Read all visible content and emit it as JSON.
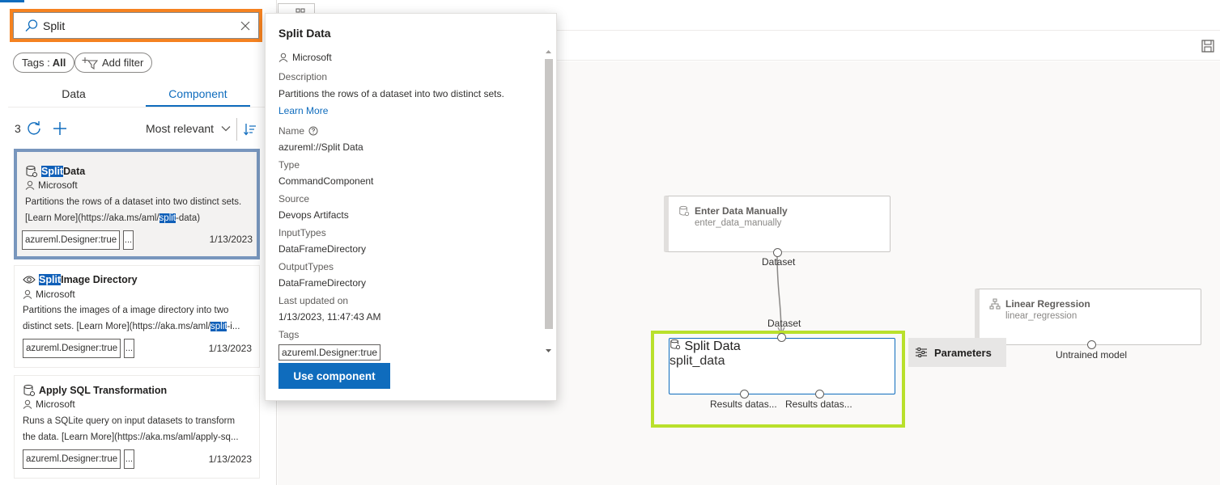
{
  "search": {
    "value": "Split",
    "placeholder": "Search"
  },
  "filters": {
    "tags_label": "Tags :",
    "tags_value": "All",
    "add_filter_label": "Add filter"
  },
  "tabs": [
    {
      "label": "Data"
    },
    {
      "label": "Component"
    }
  ],
  "list_header": {
    "count": "3",
    "sort_label": "Most relevant"
  },
  "cards": [
    {
      "title_highlight": "Split",
      "title_rest": " Data",
      "author": "Microsoft",
      "desc_line1": "Partitions the rows of a dataset into two distinct sets.",
      "desc_line2_pre": "[Learn More](https://aka.ms/aml/",
      "desc_line2_hl": "split",
      "desc_line2_post": "-data)",
      "tag": "azureml.Designer:true",
      "more": "...",
      "date": "1/13/2023"
    },
    {
      "title_highlight": "Split",
      "title_rest": " Image Directory",
      "author": "Microsoft",
      "desc_line1": "Partitions the images of a image directory into two",
      "desc_line2_pre": "distinct sets. [Learn More](https://aka.ms/aml/",
      "desc_line2_hl": "split",
      "desc_line2_post": "-i...",
      "tag": "azureml.Designer:true",
      "more": "...",
      "date": "1/13/2023"
    },
    {
      "title": "Apply SQL Transformation",
      "author": "Microsoft",
      "desc_line1": "Runs a SQLite query on input datasets to transform",
      "desc_line2": "the data. [Learn More](https://aka.ms/aml/apply-sq...",
      "tag": "azureml.Designer:true",
      "more": "...",
      "date": "1/13/2023"
    }
  ],
  "popup": {
    "title": "Split Data",
    "author": "Microsoft",
    "description_label": "Description",
    "description": "Partitions the rows of a dataset into two distinct sets.",
    "learn_more": "Learn More",
    "name_label": "Name",
    "name_value": "azureml://Split Data",
    "type_label": "Type",
    "type_value": "CommandComponent",
    "source_label": "Source",
    "source_value": "Devops Artifacts",
    "input_label": "InputTypes",
    "input_value": "DataFrameDirectory",
    "output_label": "OutputTypes",
    "output_value": "DataFrameDirectory",
    "updated_label": "Last updated on",
    "updated_value": "1/13/2023, 11:47:43 AM",
    "tags_label": "Tags",
    "tag_value": "azureml.Designer:true",
    "use_button": "Use component"
  },
  "canvas": {
    "nodes": {
      "enter_data": {
        "title": "Enter Data Manually",
        "subtitle": "enter_data_manually",
        "output_port": "Dataset"
      },
      "split_data": {
        "title": "Split Data",
        "subtitle": "split_data",
        "input_port": "Dataset",
        "output_port_1": "Results datas...",
        "output_port_2": "Results datas..."
      },
      "linear_regression": {
        "title": "Linear Regression",
        "subtitle": "linear_regression",
        "output_port": "Untrained model"
      }
    },
    "parameters_button": "Parameters"
  },
  "colors": {
    "accent": "#0f6cbd",
    "search_highlight_border": "#f58220",
    "selected_card_border": "#7896bd",
    "selected_node_outline": "#b9e02c"
  }
}
